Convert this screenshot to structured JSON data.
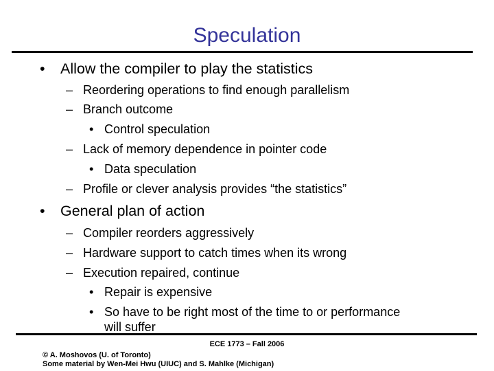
{
  "slide": {
    "title": "Speculation",
    "title_color": "#333399",
    "sections": [
      {
        "bullet": "•",
        "text": "Allow the compiler to play the statistics",
        "items": [
          {
            "bullet": "–",
            "text": "Reordering operations to find enough parallelism"
          },
          {
            "bullet": "–",
            "text": "Branch outcome",
            "sub": [
              {
                "bullet": "•",
                "text": "Control speculation"
              }
            ]
          },
          {
            "bullet": "–",
            "text": "Lack of memory dependence in pointer code",
            "sub": [
              {
                "bullet": "•",
                "text": "Data speculation"
              }
            ]
          },
          {
            "bullet": "–",
            "text": "Profile or clever analysis provides “the statistics”"
          }
        ]
      },
      {
        "bullet": "•",
        "text": "General plan of action",
        "items": [
          {
            "bullet": "–",
            "text": "Compiler reorders aggressively"
          },
          {
            "bullet": "–",
            "text": "Hardware support to catch times when its wrong"
          },
          {
            "bullet": "–",
            "text": "Execution repaired, continue",
            "sub": [
              {
                "bullet": "•",
                "text": "Repair is expensive"
              },
              {
                "bullet": "•",
                "text": "So have to be right most of the time to or performance",
                "continuation": "will suffer"
              }
            ]
          }
        ]
      }
    ]
  },
  "footer": {
    "course": "ECE 1773 – Fall 2006",
    "copyright": "© A. Moshovos (U. of Toronto)",
    "credits": "Some material by Wen-Mei Hwu (UIUC) and S. Mahlke (Michigan)"
  }
}
